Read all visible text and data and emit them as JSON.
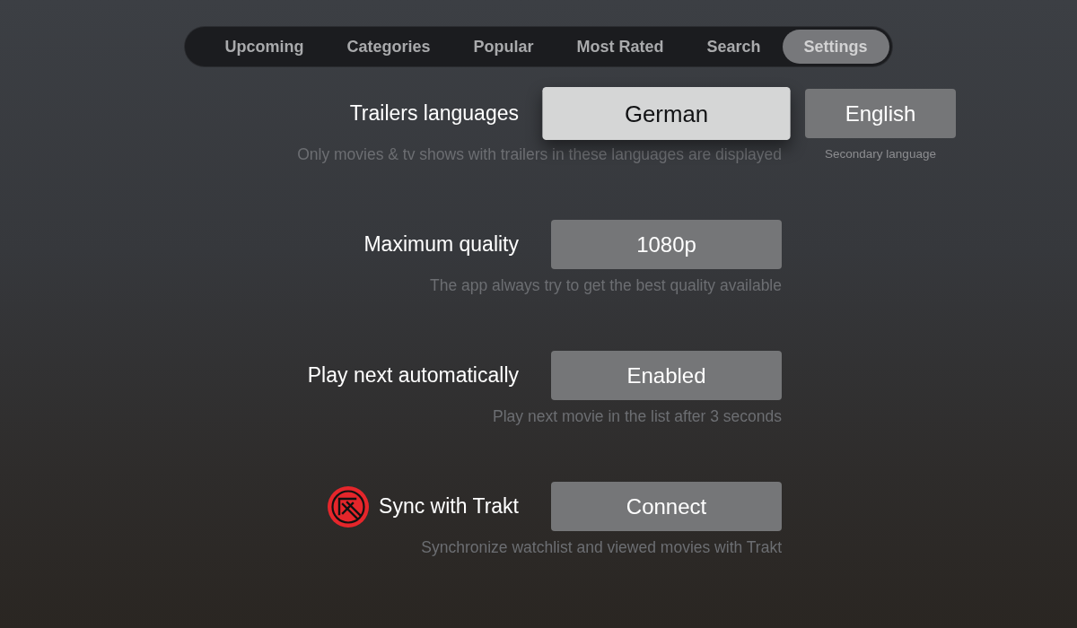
{
  "tabs": [
    {
      "label": "Upcoming",
      "selected": false
    },
    {
      "label": "Categories",
      "selected": false
    },
    {
      "label": "Popular",
      "selected": false
    },
    {
      "label": "Most Rated",
      "selected": false
    },
    {
      "label": "Search",
      "selected": false
    },
    {
      "label": "Settings",
      "selected": true
    }
  ],
  "settings": [
    {
      "kind": "plain",
      "label": "Trailers languages",
      "value": "German",
      "focused": true,
      "hint": "Only movies & tv shows with trailers in these languages are displayed",
      "secondary": {
        "value": "English",
        "focused": false,
        "caption": "Secondary language"
      }
    },
    {
      "kind": "plain",
      "label": "Maximum quality",
      "value": "1080p",
      "focused": false,
      "hint": "The app always try to get the best quality available"
    },
    {
      "kind": "plain",
      "label": "Play next automatically",
      "value": "Enabled",
      "focused": false,
      "hint": "Play next movie in the list after 3 seconds"
    },
    {
      "kind": "logo",
      "label": "Sync with Trakt",
      "value": "Connect",
      "focused": false,
      "hint": "Synchronize watchlist and viewed movies with Trakt"
    }
  ]
}
